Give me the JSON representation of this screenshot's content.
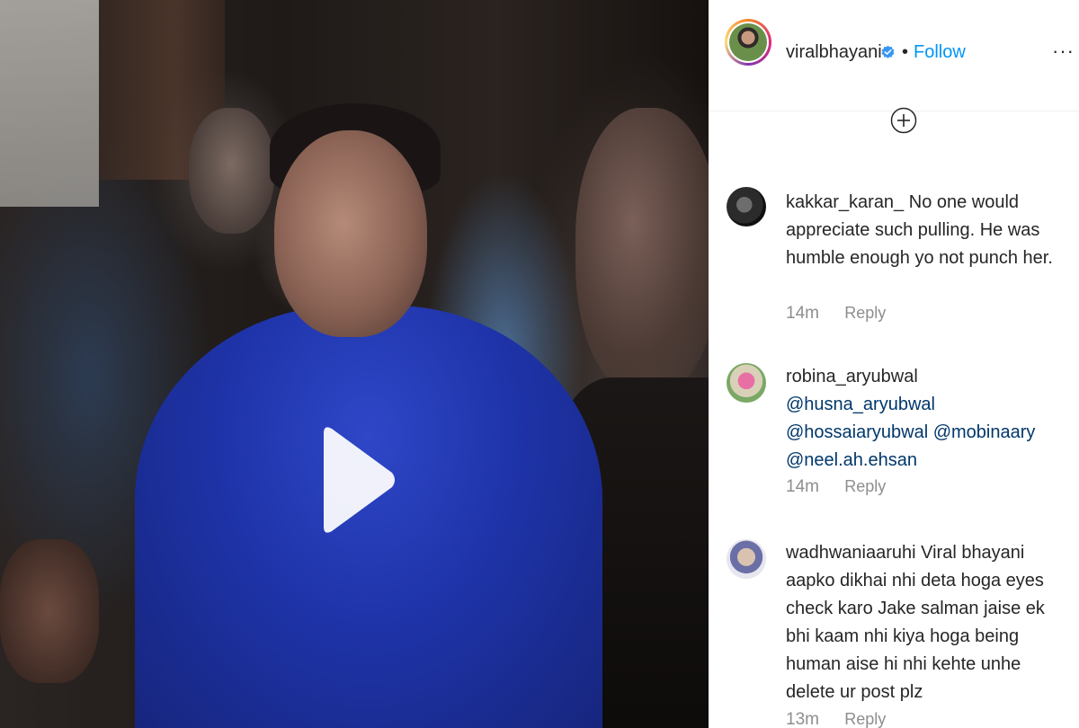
{
  "post": {
    "username": "viralbhayani",
    "separator": "•",
    "follow_label": "Follow",
    "more_label": "···"
  },
  "comments": [
    {
      "username": "kakkar_karan_",
      "text": "No one would appreciate such pulling. He was humble enough yo not punch her.",
      "time": "14m",
      "reply_label": "Reply"
    },
    {
      "username": "robina_aryubwal",
      "mentions": [
        "@husna_aryubwal",
        "@hossaiaryubwal",
        "@mobinaary",
        "@neel.ah.ehsan"
      ],
      "time": "14m",
      "reply_label": "Reply"
    },
    {
      "username": "wadhwaniaaruhi",
      "text": "Viral bhayani aapko dikhai nhi deta hoga eyes check karo Jake salman jaise ek bhi kaam nhi kiya hoga being human aise hi nhi kehte unhe delete ur post plz",
      "time": "13m",
      "reply_label": "Reply"
    }
  ],
  "colors": {
    "accent": "#0095f6",
    "mention": "#00376b",
    "muted": "#8e8e8e"
  }
}
